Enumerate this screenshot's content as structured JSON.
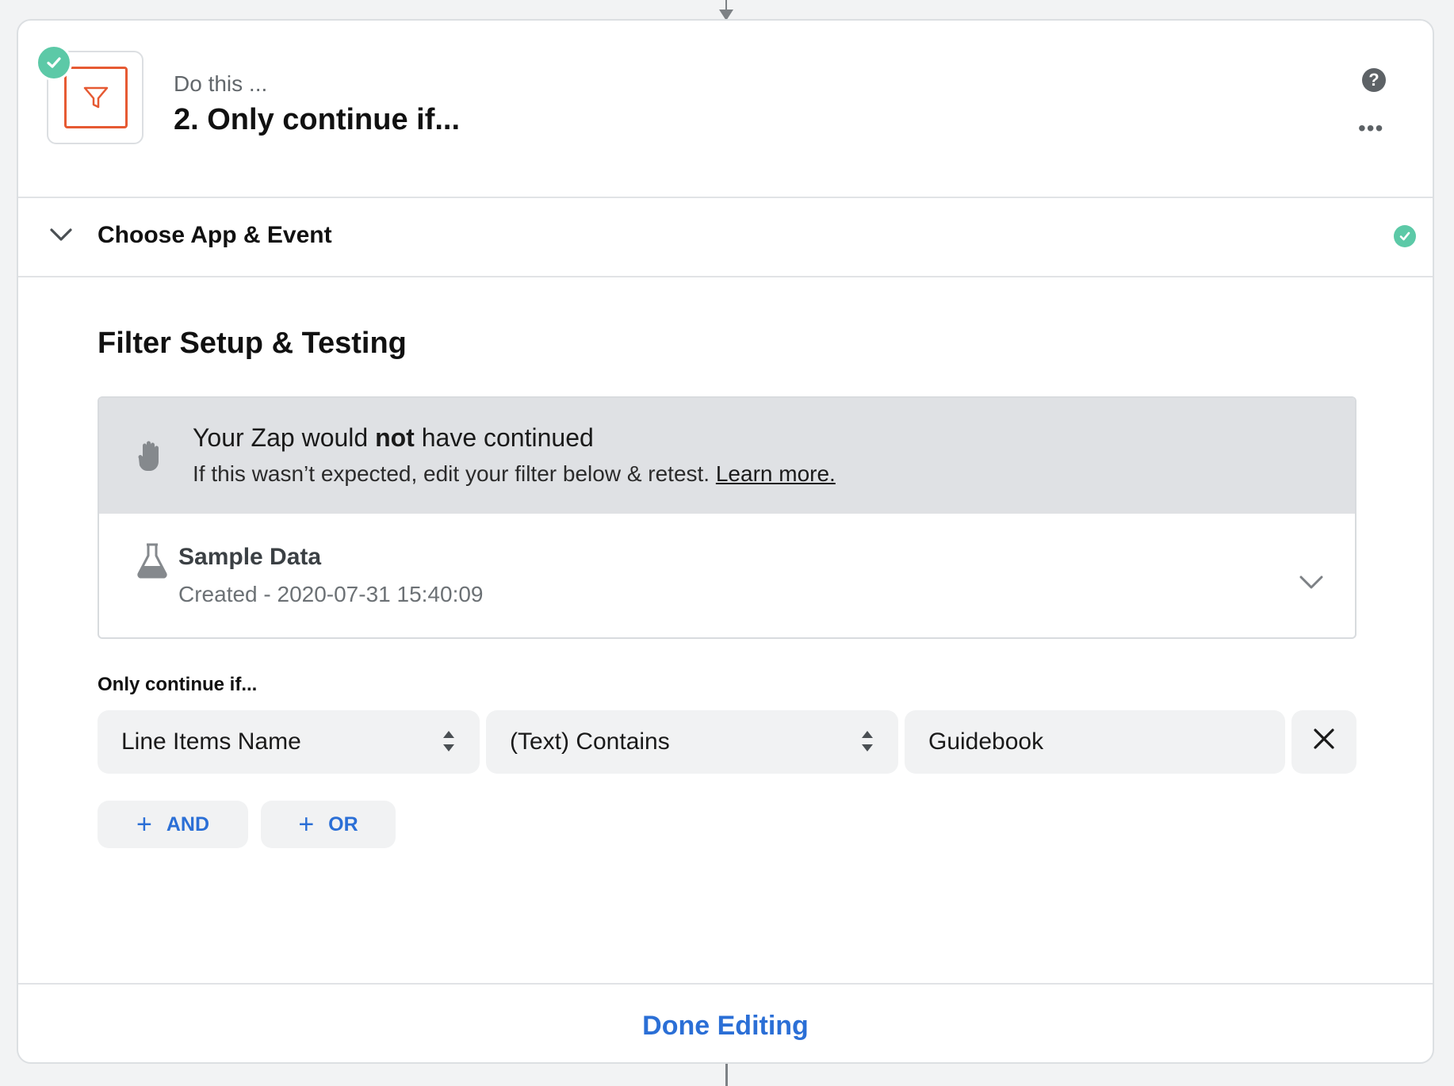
{
  "header": {
    "eyebrow": "Do this ...",
    "title": "2. Only continue if..."
  },
  "icons": {
    "app": "filter-funnel-icon",
    "status": "check-circle-icon",
    "help": "question-circle-icon",
    "more": "more-horizontal-icon",
    "collapse": "chevron-down-icon",
    "hand": "hand-stop-icon",
    "flask": "flask-icon",
    "sort": "sort-updown-icon",
    "remove": "close-icon",
    "add": "plus-icon"
  },
  "colors": {
    "accent": "#2b6fd6",
    "success": "#5cc9a7",
    "app_brand": "#e65a33"
  },
  "section": {
    "title": "Choose App & Event"
  },
  "filter": {
    "heading": "Filter Setup & Testing",
    "result_title_pre": "Your Zap would ",
    "result_title_bold": "not",
    "result_title_post": " have continued",
    "result_sub": "If this wasn’t expected, edit your filter below & retest. ",
    "learn_more": "Learn more.",
    "sample_title": "Sample Data",
    "sample_sub": "Created - 2020-07-31 15:40:09",
    "condition_label": "Only continue if...",
    "condition": {
      "field": "Line Items Name",
      "operator": "(Text) Contains",
      "value": "Guidebook"
    },
    "and_label": "AND",
    "or_label": "OR"
  },
  "footer": {
    "done_label": "Done Editing"
  }
}
